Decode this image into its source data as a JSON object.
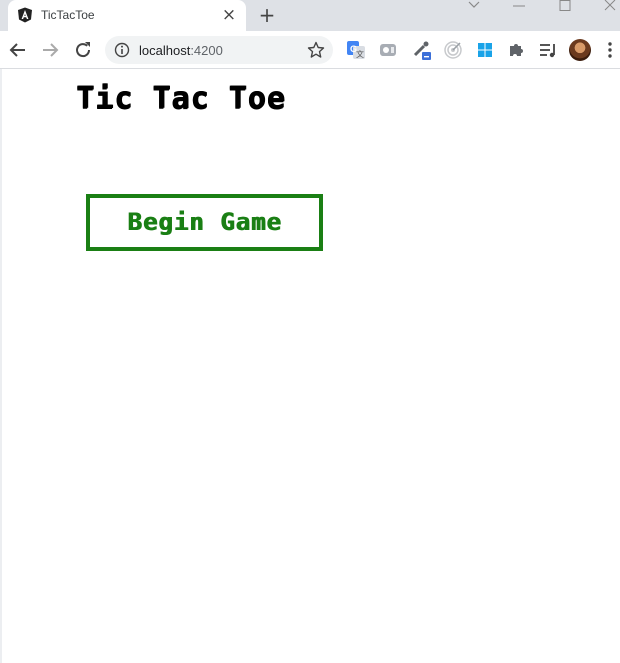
{
  "browser": {
    "tab": {
      "title": "TicTacToe",
      "favicon": "angular-logo-icon"
    },
    "address_bar": {
      "host": "localhost",
      "port": ":4200"
    },
    "window_controls": [
      "chevron-down-icon",
      "minimize-icon",
      "maximize-icon",
      "close-icon"
    ],
    "extensions": [
      "google-translate-icon",
      "screen-capture-icon",
      "color-picker-icon",
      "target-icon",
      "windows-icon",
      "puzzle-icon",
      "reading-list-icon"
    ]
  },
  "page": {
    "title": "Tic Tac Toe",
    "begin_button_label": "Begin Game"
  },
  "colors": {
    "accent_green": "#1a7f14",
    "title_black": "#000000"
  }
}
